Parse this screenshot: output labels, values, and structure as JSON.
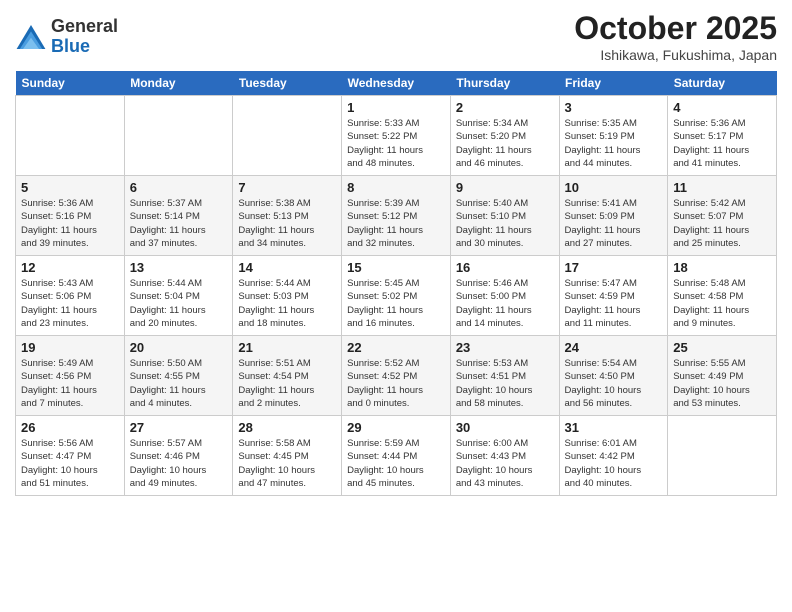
{
  "header": {
    "logo_general": "General",
    "logo_blue": "Blue",
    "month_year": "October 2025",
    "location": "Ishikawa, Fukushima, Japan"
  },
  "days_of_week": [
    "Sunday",
    "Monday",
    "Tuesday",
    "Wednesday",
    "Thursday",
    "Friday",
    "Saturday"
  ],
  "weeks": [
    [
      {
        "day": "",
        "info": ""
      },
      {
        "day": "",
        "info": ""
      },
      {
        "day": "",
        "info": ""
      },
      {
        "day": "1",
        "info": "Sunrise: 5:33 AM\nSunset: 5:22 PM\nDaylight: 11 hours\nand 48 minutes."
      },
      {
        "day": "2",
        "info": "Sunrise: 5:34 AM\nSunset: 5:20 PM\nDaylight: 11 hours\nand 46 minutes."
      },
      {
        "day": "3",
        "info": "Sunrise: 5:35 AM\nSunset: 5:19 PM\nDaylight: 11 hours\nand 44 minutes."
      },
      {
        "day": "4",
        "info": "Sunrise: 5:36 AM\nSunset: 5:17 PM\nDaylight: 11 hours\nand 41 minutes."
      }
    ],
    [
      {
        "day": "5",
        "info": "Sunrise: 5:36 AM\nSunset: 5:16 PM\nDaylight: 11 hours\nand 39 minutes."
      },
      {
        "day": "6",
        "info": "Sunrise: 5:37 AM\nSunset: 5:14 PM\nDaylight: 11 hours\nand 37 minutes."
      },
      {
        "day": "7",
        "info": "Sunrise: 5:38 AM\nSunset: 5:13 PM\nDaylight: 11 hours\nand 34 minutes."
      },
      {
        "day": "8",
        "info": "Sunrise: 5:39 AM\nSunset: 5:12 PM\nDaylight: 11 hours\nand 32 minutes."
      },
      {
        "day": "9",
        "info": "Sunrise: 5:40 AM\nSunset: 5:10 PM\nDaylight: 11 hours\nand 30 minutes."
      },
      {
        "day": "10",
        "info": "Sunrise: 5:41 AM\nSunset: 5:09 PM\nDaylight: 11 hours\nand 27 minutes."
      },
      {
        "day": "11",
        "info": "Sunrise: 5:42 AM\nSunset: 5:07 PM\nDaylight: 11 hours\nand 25 minutes."
      }
    ],
    [
      {
        "day": "12",
        "info": "Sunrise: 5:43 AM\nSunset: 5:06 PM\nDaylight: 11 hours\nand 23 minutes."
      },
      {
        "day": "13",
        "info": "Sunrise: 5:44 AM\nSunset: 5:04 PM\nDaylight: 11 hours\nand 20 minutes."
      },
      {
        "day": "14",
        "info": "Sunrise: 5:44 AM\nSunset: 5:03 PM\nDaylight: 11 hours\nand 18 minutes."
      },
      {
        "day": "15",
        "info": "Sunrise: 5:45 AM\nSunset: 5:02 PM\nDaylight: 11 hours\nand 16 minutes."
      },
      {
        "day": "16",
        "info": "Sunrise: 5:46 AM\nSunset: 5:00 PM\nDaylight: 11 hours\nand 14 minutes."
      },
      {
        "day": "17",
        "info": "Sunrise: 5:47 AM\nSunset: 4:59 PM\nDaylight: 11 hours\nand 11 minutes."
      },
      {
        "day": "18",
        "info": "Sunrise: 5:48 AM\nSunset: 4:58 PM\nDaylight: 11 hours\nand 9 minutes."
      }
    ],
    [
      {
        "day": "19",
        "info": "Sunrise: 5:49 AM\nSunset: 4:56 PM\nDaylight: 11 hours\nand 7 minutes."
      },
      {
        "day": "20",
        "info": "Sunrise: 5:50 AM\nSunset: 4:55 PM\nDaylight: 11 hours\nand 4 minutes."
      },
      {
        "day": "21",
        "info": "Sunrise: 5:51 AM\nSunset: 4:54 PM\nDaylight: 11 hours\nand 2 minutes."
      },
      {
        "day": "22",
        "info": "Sunrise: 5:52 AM\nSunset: 4:52 PM\nDaylight: 11 hours\nand 0 minutes."
      },
      {
        "day": "23",
        "info": "Sunrise: 5:53 AM\nSunset: 4:51 PM\nDaylight: 10 hours\nand 58 minutes."
      },
      {
        "day": "24",
        "info": "Sunrise: 5:54 AM\nSunset: 4:50 PM\nDaylight: 10 hours\nand 56 minutes."
      },
      {
        "day": "25",
        "info": "Sunrise: 5:55 AM\nSunset: 4:49 PM\nDaylight: 10 hours\nand 53 minutes."
      }
    ],
    [
      {
        "day": "26",
        "info": "Sunrise: 5:56 AM\nSunset: 4:47 PM\nDaylight: 10 hours\nand 51 minutes."
      },
      {
        "day": "27",
        "info": "Sunrise: 5:57 AM\nSunset: 4:46 PM\nDaylight: 10 hours\nand 49 minutes."
      },
      {
        "day": "28",
        "info": "Sunrise: 5:58 AM\nSunset: 4:45 PM\nDaylight: 10 hours\nand 47 minutes."
      },
      {
        "day": "29",
        "info": "Sunrise: 5:59 AM\nSunset: 4:44 PM\nDaylight: 10 hours\nand 45 minutes."
      },
      {
        "day": "30",
        "info": "Sunrise: 6:00 AM\nSunset: 4:43 PM\nDaylight: 10 hours\nand 43 minutes."
      },
      {
        "day": "31",
        "info": "Sunrise: 6:01 AM\nSunset: 4:42 PM\nDaylight: 10 hours\nand 40 minutes."
      },
      {
        "day": "",
        "info": ""
      }
    ]
  ]
}
